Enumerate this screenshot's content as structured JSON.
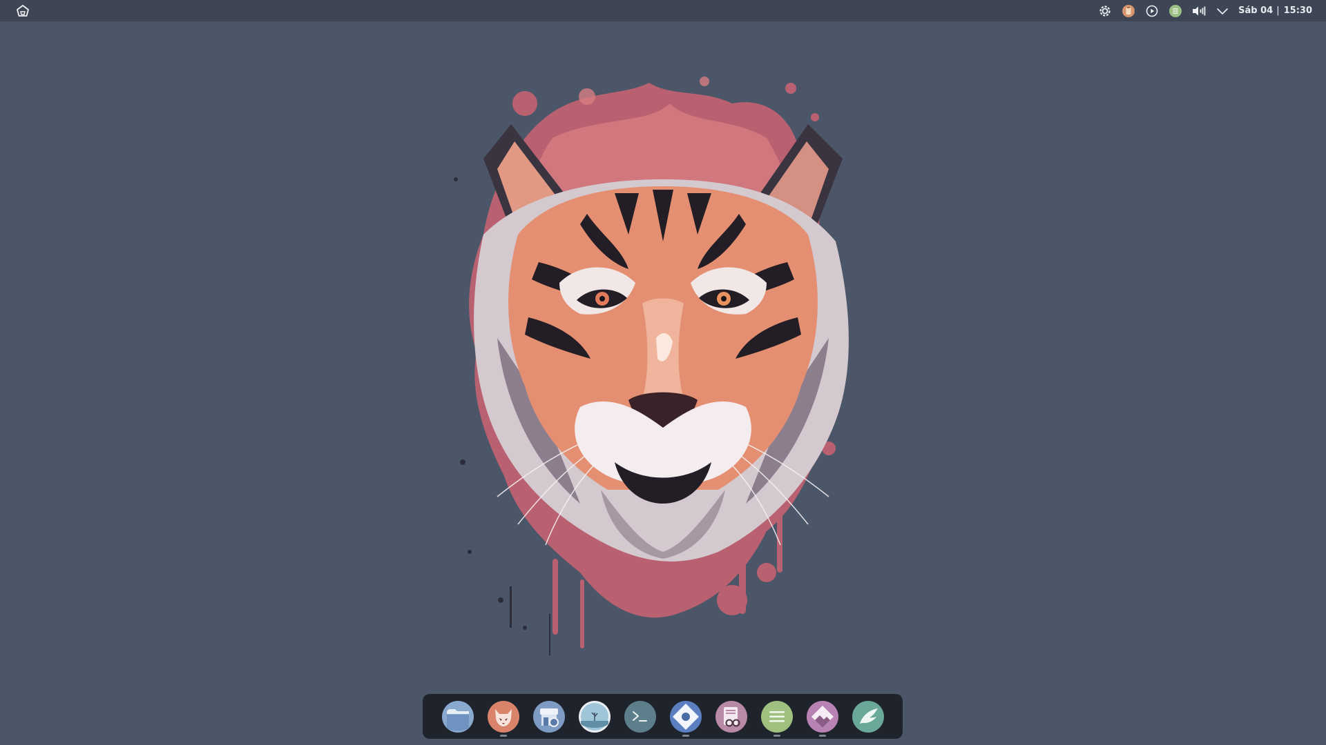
{
  "top_bar": {
    "clock": {
      "date": "Sáb 04",
      "separator": "|",
      "time": "15:30"
    },
    "tray_icons": [
      "settings-gear-icon",
      "clipboard-icon",
      "media-play-icon",
      "notes-icon",
      "volume-icon",
      "chevron-down-icon"
    ]
  },
  "dock": {
    "items": [
      {
        "name": "files",
        "icon": "folder-icon",
        "running": false
      },
      {
        "name": "firefox",
        "icon": "firefox-icon",
        "running": true
      },
      {
        "name": "software-store",
        "icon": "store-icon",
        "running": false
      },
      {
        "name": "image-viewer",
        "icon": "landscape-icon",
        "running": false
      },
      {
        "name": "terminal",
        "icon": "terminal-icon",
        "running": false
      },
      {
        "name": "pamac-package-manager",
        "icon": "package-icon",
        "running": true
      },
      {
        "name": "reader",
        "icon": "reader-icon",
        "running": false
      },
      {
        "name": "notes",
        "icon": "list-icon",
        "running": true
      },
      {
        "name": "kvantum",
        "icon": "diamond-icon",
        "running": true
      },
      {
        "name": "welcome",
        "icon": "wing-icon",
        "running": false
      }
    ]
  },
  "colors": {
    "desktop_background": "#4c5669",
    "panel_background": "#3e4656",
    "dock_background": "#1f242c",
    "accent_salmon": "#d9846a",
    "accent_pink": "#c86878"
  }
}
